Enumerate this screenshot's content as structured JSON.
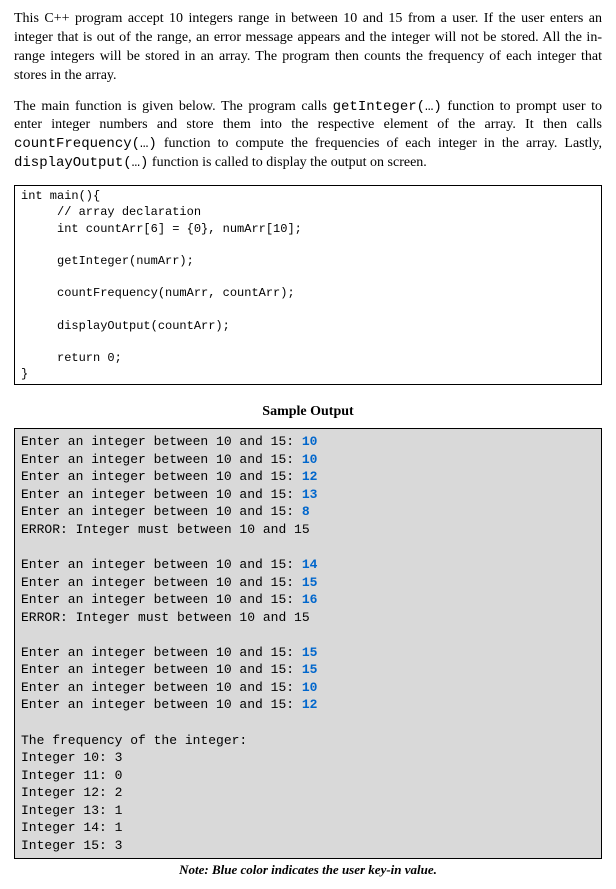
{
  "p1_a": "This C++ program accept 10 integers range in between 10 and 15 from a user. If the user enters an integer that is out of the range, an error message appears and the integer will not be stored. All the in-range integers will be stored in an array. The program then counts the frequency of each integer that stores in the array.",
  "p2_a": "The main function is given below. The program calls ",
  "p2_b": "getInteger(…)",
  "p2_c": " function to prompt user to enter integer numbers and store them into the respective element of the array. It then calls ",
  "p2_d": "countFrequency(…)",
  "p2_e": " function to compute the frequencies of each integer in the array. Lastly, ",
  "p2_f": "displayOutput(…)",
  "p2_g": " function is called to display the output on screen.",
  "code": "int main(){\n     // array declaration\n     int countArr[6] = {0}, numArr[10];\n\n     getInteger(numArr);\n\n     countFrequency(numArr, countArr);\n\n     displayOutput(countArr);\n\n     return 0;\n}",
  "sample_heading": "Sample Output",
  "prompt": "Enter an integer between 10 and 15: ",
  "error": "ERROR: Integer must between 10 and 15",
  "inputs_block1": [
    "10",
    "10",
    "12",
    "13",
    "8"
  ],
  "inputs_block2": [
    "14",
    "15",
    "16"
  ],
  "inputs_block3": [
    "15",
    "15",
    "10",
    "12"
  ],
  "freq_header": "The frequency of the integer:",
  "freq_lines": [
    "Integer 10: 3",
    "Integer 11: 0",
    "Integer 12: 2",
    "Integer 13: 1",
    "Integer 14: 1",
    "Integer 15: 3"
  ],
  "note": "Note: Blue color indicates the user key-in value."
}
